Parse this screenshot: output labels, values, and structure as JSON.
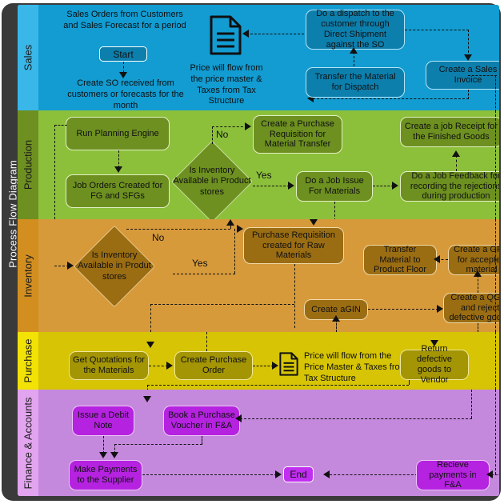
{
  "diagram": {
    "title": "Process Flow Diagram",
    "lanes": [
      {
        "id": "sales",
        "label": "Sales",
        "head_color": "#39b7e8",
        "body_color": "#129cd2",
        "node_color": "#0d7fad",
        "nodes": [
          {
            "name": "sales-orders-caption",
            "text": "Sales Orders from Customers and Sales Forecast for a period",
            "kind": "caption"
          },
          {
            "name": "start-pill",
            "text": "Start",
            "kind": "pill"
          },
          {
            "name": "create-so-caption",
            "text": "Create SO received from customers or forecasts for the month",
            "kind": "caption"
          },
          {
            "name": "price-flow-sales-caption",
            "text": "Price will flow from the price master & Taxes from Tax Structure",
            "kind": "caption"
          },
          {
            "name": "do-a-dispatch-node",
            "text": "Do a dispatch to the customer through Direct Shipment against the SO",
            "kind": "box"
          },
          {
            "name": "create-sales-invoice-node",
            "text": "Create a Sales Invoice",
            "kind": "box"
          },
          {
            "name": "transfer-material-dispatch-node",
            "text": "Transfer the Material for Dispatch",
            "kind": "box"
          }
        ]
      },
      {
        "id": "production",
        "label": "Production",
        "head_color": "#6d9020",
        "body_color": "#8cc03b",
        "node_color": "#6d9020",
        "nodes": [
          {
            "name": "run-planning-engine-node",
            "text": "Run Planning Engine",
            "kind": "box"
          },
          {
            "name": "job-orders-created-node",
            "text": "Job Orders Created for FG and SFGs",
            "kind": "box"
          },
          {
            "name": "inventory-available-product-stores-decision",
            "text": "Is Inventory Available in Product stores",
            "kind": "diamond"
          },
          {
            "name": "create-purchase-requisition-transfer-node",
            "text": "Create a Purchase Requisition for Material Transfer",
            "kind": "box"
          },
          {
            "name": "do-a-job-issue-node",
            "text": "Do a Job Issue For Materials",
            "kind": "box"
          },
          {
            "name": "do-a-job-feedback-node",
            "text": "Do a Job Feedback for recording the rejections during production",
            "kind": "box"
          },
          {
            "name": "create-job-receipt-node",
            "text": "Create a job Receipt for the Finished Goods",
            "kind": "box"
          }
        ],
        "edge_labels": {
          "no": "No",
          "yes": "Yes"
        }
      },
      {
        "id": "inventory",
        "label": "Inventory",
        "head_color": "#d28e1f",
        "body_color": "#d79a3b",
        "node_color": "#9b6d13",
        "nodes": [
          {
            "name": "inventory-available-produt-stores-decision",
            "text": "Is Inventory Available in Produt stores",
            "kind": "diamond"
          },
          {
            "name": "purchase-requisition-raw-materials-node",
            "text": "Purchase Requisition created for Raw Materials",
            "kind": "box"
          },
          {
            "name": "transfer-material-product-floor-node",
            "text": "Transfer Material to Product Floor",
            "kind": "box"
          },
          {
            "name": "create-grn-node",
            "text": "Create a GRN for accepted material",
            "kind": "box"
          },
          {
            "name": "create-agin-node",
            "text": "Create aGIN",
            "kind": "box"
          },
          {
            "name": "create-qgin-node",
            "text": "Create a QGIN and reject defective goods",
            "kind": "box"
          }
        ],
        "edge_labels": {
          "no": "No",
          "yes": "Yes"
        }
      },
      {
        "id": "purchase",
        "label": "Purchase",
        "head_color": "#f2e205",
        "body_color": "#d6c405",
        "node_color": "#a39504",
        "nodes": [
          {
            "name": "get-quotations-node",
            "text": "Get Quotations for the Materials",
            "kind": "box"
          },
          {
            "name": "create-purchase-order-node",
            "text": "Create Purchase Order",
            "kind": "box"
          },
          {
            "name": "price-flow-purchase-caption",
            "text": "Price will flow from the Price Master & Taxes from Tax Structure",
            "kind": "caption"
          },
          {
            "name": "return-defective-goods-node",
            "text": "Return defective goods to Vendor",
            "kind": "box"
          }
        ]
      },
      {
        "id": "finance",
        "label": "Finance & Accounts",
        "head_color": "#e2a4ef",
        "body_color": "#c489dd",
        "node_color": "#b522e0",
        "nodes": [
          {
            "name": "issue-debit-note-node",
            "text": "Issue a Debit Note",
            "kind": "box"
          },
          {
            "name": "book-purchase-voucher-node",
            "text": "Book a Purchase Voucher in F&A",
            "kind": "box"
          },
          {
            "name": "make-payments-supplier-node",
            "text": "Make Payments to the Supplier",
            "kind": "box"
          },
          {
            "name": "end-pill",
            "text": "End",
            "kind": "pill"
          },
          {
            "name": "recieve-payments-node",
            "text": "Recieve payments in F&A",
            "kind": "box"
          }
        ]
      }
    ],
    "icons": [
      {
        "name": "document-icon-sales",
        "semantic": "document-icon"
      },
      {
        "name": "document-icon-purchase",
        "semantic": "document-icon"
      }
    ]
  }
}
